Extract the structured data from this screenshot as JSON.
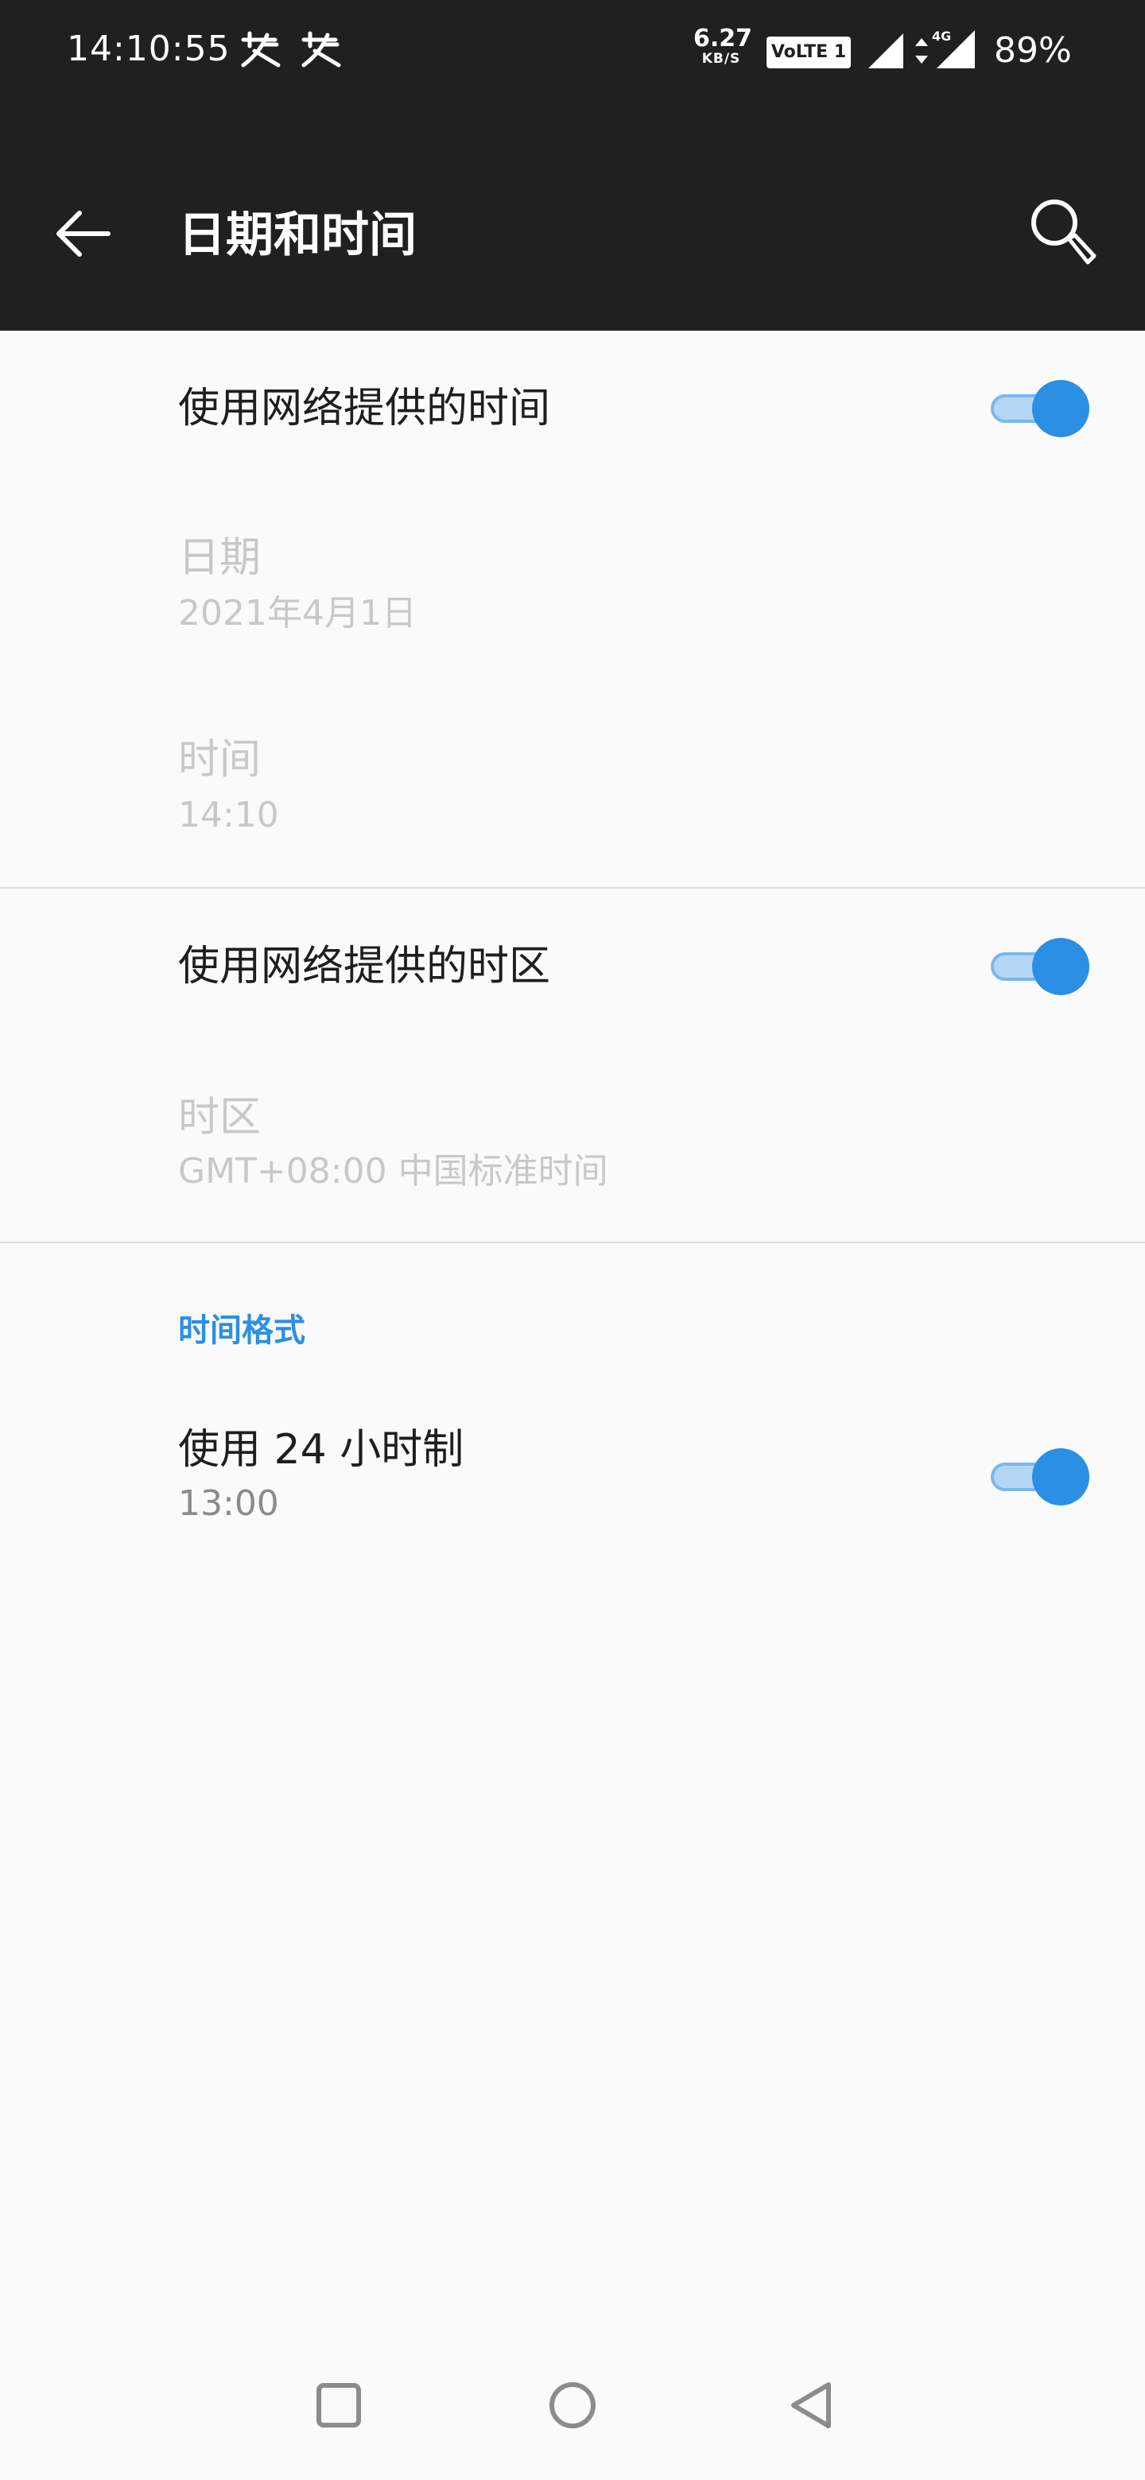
{
  "status_bar": {
    "time": "14:10:55",
    "net_speed_value": "6.27",
    "net_speed_unit": "KB/S",
    "volte_label": "VoLTE 1",
    "network_type": "4G",
    "battery": "89%",
    "notification_icons": [
      "app-notification-icon",
      "app-notification-icon"
    ]
  },
  "header": {
    "title": "日期和时间",
    "back_icon": "arrow-left-icon",
    "search_icon": "search-icon"
  },
  "settings": {
    "auto_time": {
      "title": "使用网络提供的时间",
      "enabled": true
    },
    "date": {
      "title": "日期",
      "value": "2021年4月1日",
      "disabled": true
    },
    "time": {
      "title": "时间",
      "value": "14:10",
      "disabled": true
    },
    "auto_timezone": {
      "title": "使用网络提供的时区",
      "enabled": true
    },
    "timezone": {
      "title": "时区",
      "value": "GMT+08:00 中国标准时间",
      "disabled": true
    },
    "time_format_section": {
      "header": "时间格式"
    },
    "use_24_hour": {
      "title": "使用 24 小时制",
      "value": "13:00",
      "enabled": true
    }
  },
  "colors": {
    "accent": "#2b8fe4",
    "appbar_bg": "#202020",
    "page_bg": "#fafafa"
  },
  "nav_bar": {
    "recents_icon": "square-recents-icon",
    "home_icon": "circle-home-icon",
    "back_icon": "triangle-back-icon"
  }
}
